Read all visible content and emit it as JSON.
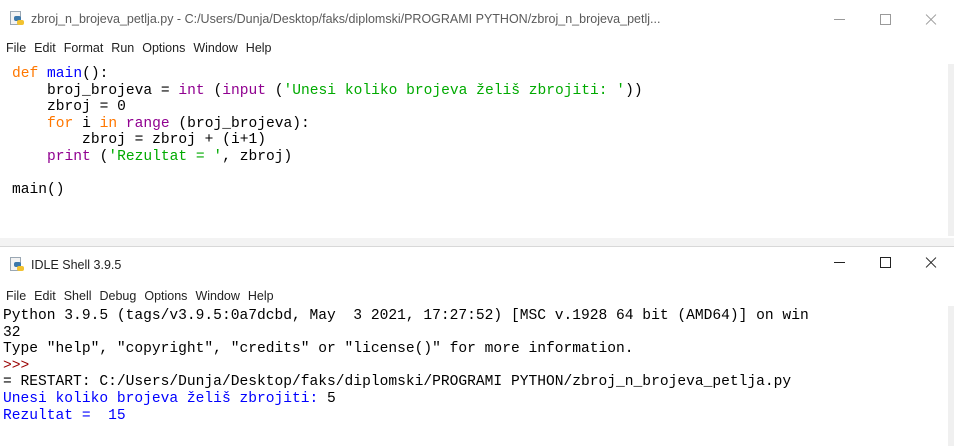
{
  "editor": {
    "title": "zbroj_n_brojeva_petlja.py - C:/Users/Dunja/Desktop/faks/diplomski/PROGRAMI PYTHON/zbroj_n_brojeva_petlj...",
    "menu": [
      "File",
      "Edit",
      "Format",
      "Run",
      "Options",
      "Window",
      "Help"
    ],
    "code": [
      [
        {
          "t": "def",
          "c": "kw"
        },
        {
          "t": " ",
          "c": "blk"
        },
        {
          "t": "main",
          "c": "def"
        },
        {
          "t": "():",
          "c": "blk"
        }
      ],
      [
        {
          "t": "    broj_brojeva = ",
          "c": "blk"
        },
        {
          "t": "int",
          "c": "bi"
        },
        {
          "t": " (",
          "c": "blk"
        },
        {
          "t": "input",
          "c": "bi"
        },
        {
          "t": " (",
          "c": "blk"
        },
        {
          "t": "'Unesi koliko brojeva želiš zbrojiti: '",
          "c": "str"
        },
        {
          "t": "))",
          "c": "blk"
        }
      ],
      [
        {
          "t": "    zbroj = 0",
          "c": "blk"
        }
      ],
      [
        {
          "t": "    ",
          "c": "blk"
        },
        {
          "t": "for",
          "c": "kw"
        },
        {
          "t": " i ",
          "c": "blk"
        },
        {
          "t": "in",
          "c": "kw"
        },
        {
          "t": " ",
          "c": "blk"
        },
        {
          "t": "range",
          "c": "bi"
        },
        {
          "t": " (broj_brojeva):",
          "c": "blk"
        }
      ],
      [
        {
          "t": "        zbroj = zbroj + (i+1)",
          "c": "blk"
        }
      ],
      [
        {
          "t": "    ",
          "c": "blk"
        },
        {
          "t": "print",
          "c": "bi"
        },
        {
          "t": " (",
          "c": "blk"
        },
        {
          "t": "'Rezultat = '",
          "c": "str"
        },
        {
          "t": ", zbroj)",
          "c": "blk"
        }
      ],
      [
        {
          "t": "",
          "c": "blk"
        }
      ],
      [
        {
          "t": "main()",
          "c": "blk"
        }
      ]
    ]
  },
  "shell": {
    "title": "IDLE Shell 3.9.5",
    "menu": [
      "File",
      "Edit",
      "Shell",
      "Debug",
      "Options",
      "Window",
      "Help"
    ],
    "lines": [
      [
        {
          "t": "Python 3.9.5 (tags/v3.9.5:0a7dcbd, May  3 2021, 17:27:52) [MSC v.1928 64 bit (AMD64)] on win",
          "c": "blk"
        }
      ],
      [
        {
          "t": "32",
          "c": "blk"
        }
      ],
      [
        {
          "t": "Type \"help\", \"copyright\", \"credits\" or \"license()\" for more information.",
          "c": "blk"
        }
      ],
      [
        {
          "t": ">>> ",
          "c": "prompt"
        }
      ],
      [
        {
          "t": "= RESTART: C:/Users/Dunja/Desktop/faks/diplomski/PROGRAMI PYTHON/zbroj_n_brojeva_petlja.py",
          "c": "blk"
        }
      ],
      [
        {
          "t": "Unesi koliko brojeva želiš zbrojiti: ",
          "c": "out"
        },
        {
          "t": "5",
          "c": "blk"
        }
      ],
      [
        {
          "t": "Rezultat =  15",
          "c": "out"
        }
      ]
    ]
  }
}
